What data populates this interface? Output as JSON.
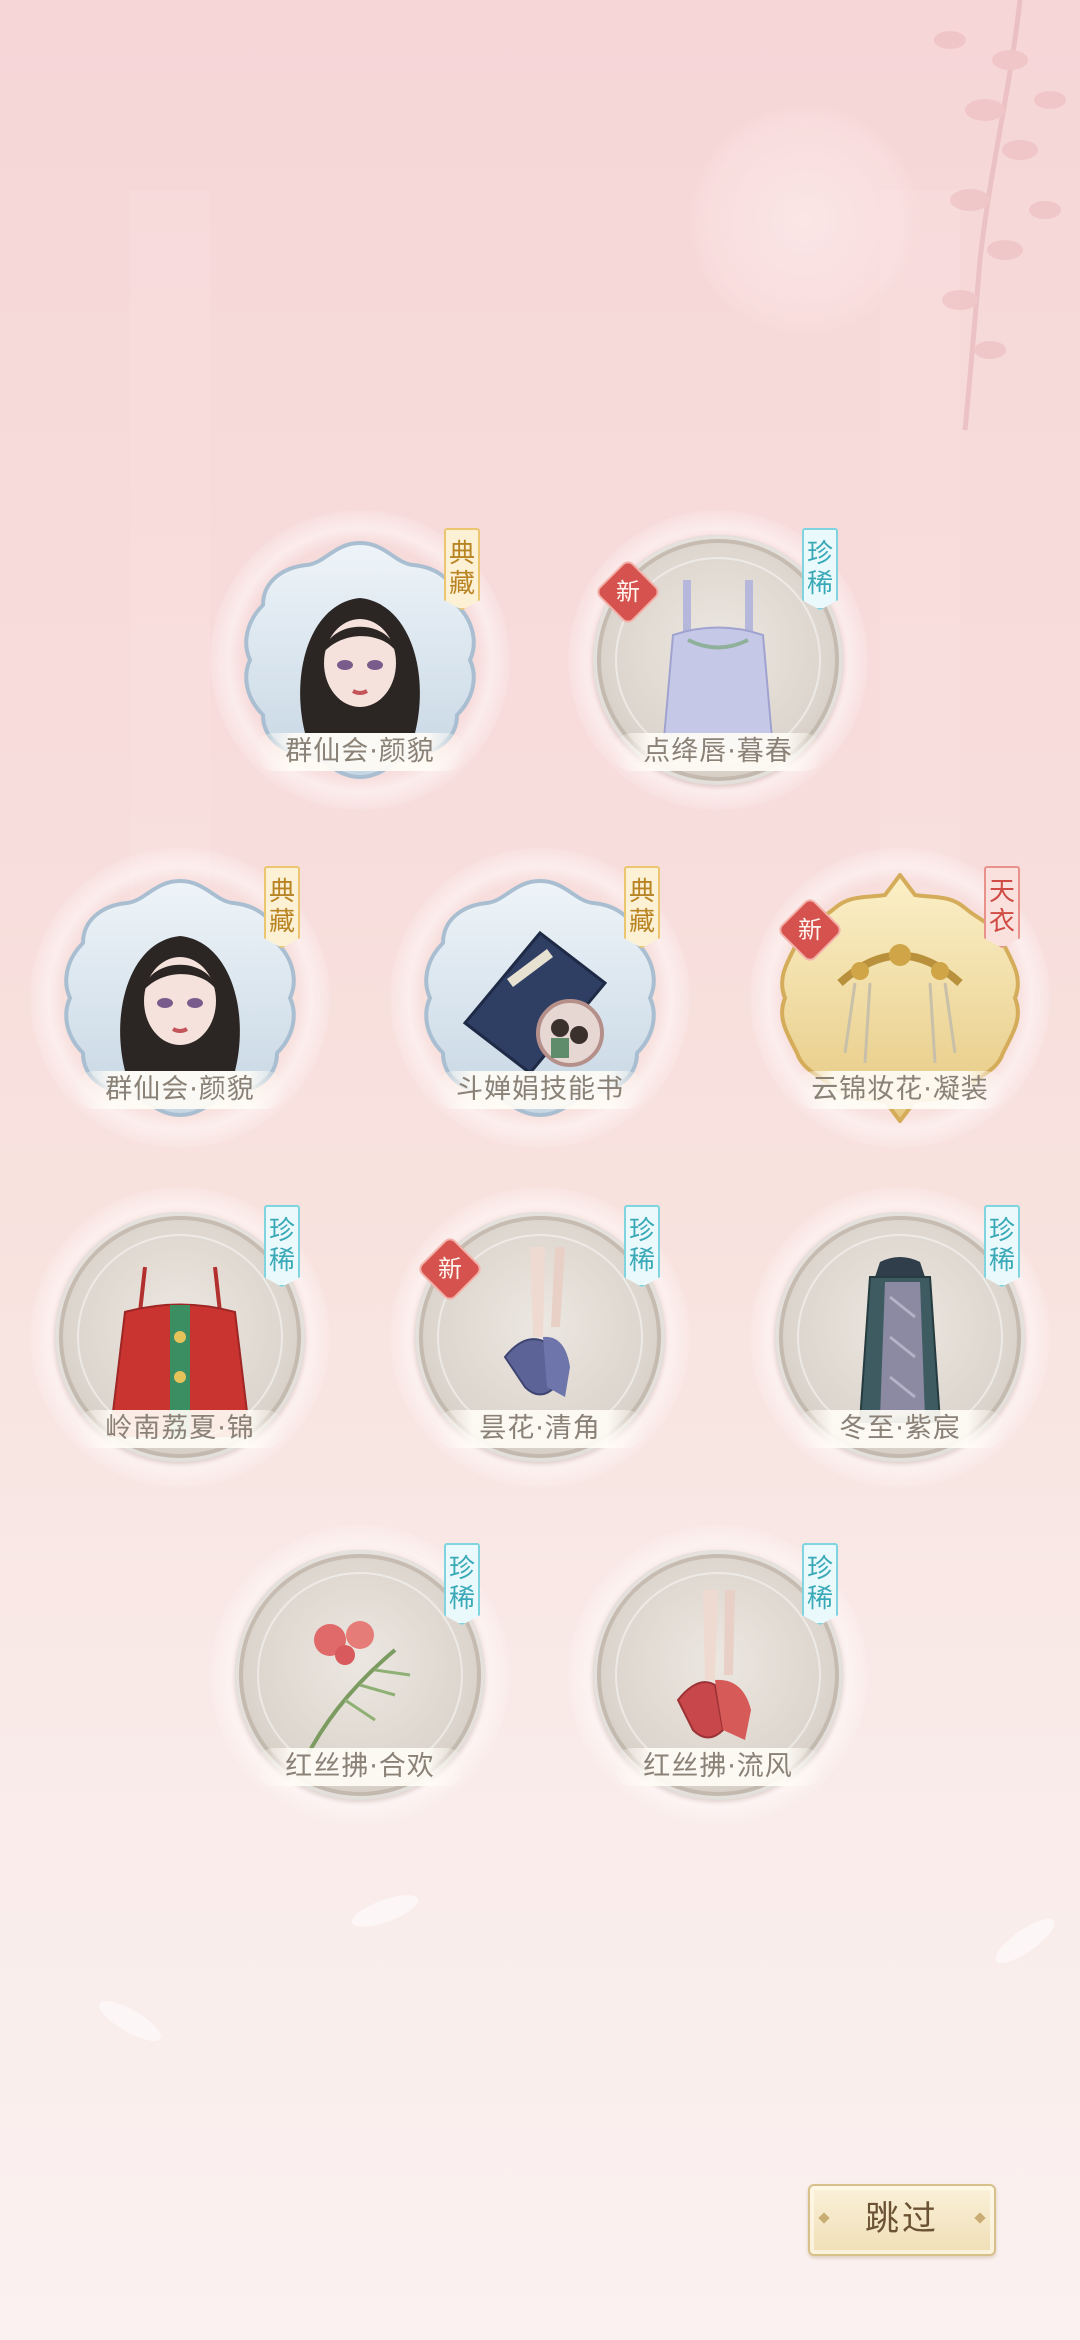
{
  "items": [
    {
      "name": "群仙会·颜貌",
      "rarity": [
        "典",
        "藏"
      ],
      "rarity_color": "gold",
      "frame": "cloud-blue",
      "icon": "face-portrait-icon",
      "is_new": false
    },
    {
      "name": "点绛唇·暮春",
      "rarity": [
        "珍",
        "稀"
      ],
      "rarity_color": "cyan",
      "frame": "plain",
      "icon": "dress-top-icon",
      "is_new": true
    },
    {
      "name": "群仙会·颜貌",
      "rarity": [
        "典",
        "藏"
      ],
      "rarity_color": "gold",
      "frame": "cloud-blue",
      "icon": "face-portrait-icon",
      "is_new": false
    },
    {
      "name": "斗婵娟技能书",
      "rarity": [
        "典",
        "藏"
      ],
      "rarity_color": "gold",
      "frame": "cloud-blue",
      "icon": "skill-book-icon",
      "is_new": false
    },
    {
      "name": "云锦妆花·凝装",
      "rarity": [
        "天",
        "衣"
      ],
      "rarity_color": "red",
      "frame": "cloud-gold",
      "icon": "hair-ornament-icon",
      "is_new": true
    },
    {
      "name": "岭南荔夏·锦",
      "rarity": [
        "珍",
        "稀"
      ],
      "rarity_color": "cyan",
      "frame": "plain",
      "icon": "red-dress-icon",
      "is_new": false
    },
    {
      "name": "昙花·清角",
      "rarity": [
        "珍",
        "稀"
      ],
      "rarity_color": "cyan",
      "frame": "plain",
      "icon": "blue-shoes-icon",
      "is_new": true
    },
    {
      "name": "冬至·紫宸",
      "rarity": [
        "珍",
        "稀"
      ],
      "rarity_color": "cyan",
      "frame": "plain",
      "icon": "cape-icon",
      "is_new": false
    },
    {
      "name": "红丝拂·合欢",
      "rarity": [
        "珍",
        "稀"
      ],
      "rarity_color": "cyan",
      "frame": "plain",
      "icon": "flower-branch-icon",
      "is_new": false
    },
    {
      "name": "红丝拂·流风",
      "rarity": [
        "珍",
        "稀"
      ],
      "rarity_color": "cyan",
      "frame": "plain",
      "icon": "red-shoes-icon",
      "is_new": false
    }
  ],
  "new_label": "新",
  "skip_label": "跳过"
}
